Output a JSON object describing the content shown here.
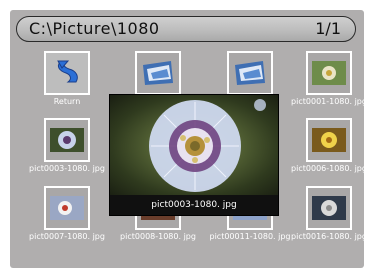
{
  "header": {
    "path": "C:\\Picture\\1080",
    "page_indicator": "1/1"
  },
  "grid": {
    "items": [
      {
        "label": "Return",
        "icon": "return-arrow-icon"
      },
      {
        "label": "",
        "icon": "folder-image-icon"
      },
      {
        "label": "",
        "icon": "folder-image-icon"
      },
      {
        "label": "pict0001-1080. jpg",
        "icon": "photo-thumbnail"
      },
      {
        "label": "pict0003-1080. jpg",
        "icon": "photo-thumbnail"
      },
      {
        "label": "",
        "icon": ""
      },
      {
        "label": "",
        "icon": ""
      },
      {
        "label": "pict0006-1080. jpg",
        "icon": "photo-thumbnail"
      },
      {
        "label": "pict0007-1080. jpg",
        "icon": "photo-thumbnail"
      },
      {
        "label": "pict0008-1080. jpg",
        "icon": "photo-thumbnail"
      },
      {
        "label": "pict00011-1080. jpg",
        "icon": "photo-thumbnail"
      },
      {
        "label": "pict0016-1080. jpg",
        "icon": "photo-thumbnail"
      }
    ]
  },
  "preview": {
    "caption": "pict0003-1080. jpg",
    "subject": "passion-flower-photo"
  }
}
